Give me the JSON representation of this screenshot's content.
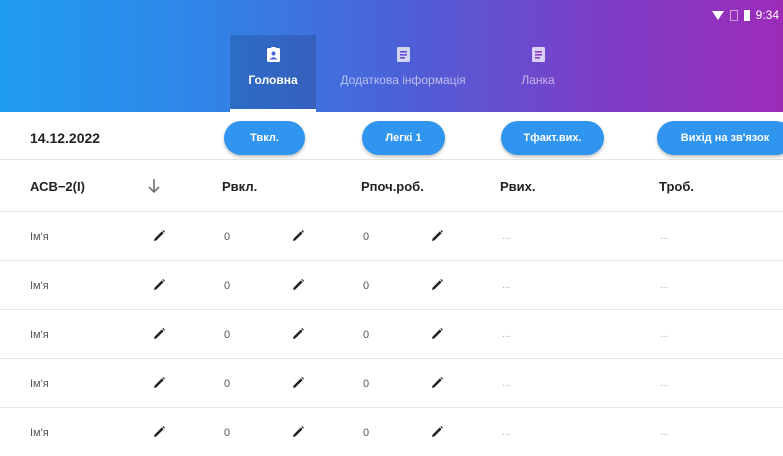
{
  "status_bar": {
    "time": "9:34"
  },
  "tabs": [
    {
      "label": "Головна",
      "active": true
    },
    {
      "label": "Додаткова інформація",
      "active": false
    },
    {
      "label": "Ланка",
      "active": false
    }
  ],
  "toolbar": {
    "date": "14.12.2022",
    "buttons": [
      "Твкл.",
      "Легкі 1",
      "Тфакт.вих.",
      "Вихід на зв'язок"
    ]
  },
  "table": {
    "headers": [
      "АСВ−2(І)",
      "Рвкл.",
      "Рпоч.роб.",
      "Рвих.",
      "Троб."
    ],
    "rows": [
      {
        "name": "Ім'я",
        "p_vkl": "0",
        "p_poch": "0",
        "p_vykh": "...",
        "t_rob": "..."
      },
      {
        "name": "Ім'я",
        "p_vkl": "0",
        "p_poch": "0",
        "p_vykh": "...",
        "t_rob": "..."
      },
      {
        "name": "Ім'я",
        "p_vkl": "0",
        "p_poch": "0",
        "p_vykh": "...",
        "t_rob": "..."
      },
      {
        "name": "Ім'я",
        "p_vkl": "0",
        "p_poch": "0",
        "p_vykh": "...",
        "t_rob": "..."
      },
      {
        "name": "Ім'я",
        "p_vkl": "0",
        "p_poch": "0",
        "p_vykh": "...",
        "t_rob": "..."
      }
    ]
  },
  "colors": {
    "gradient_start": "#1f9cf0",
    "gradient_end": "#9c2cb8",
    "button": "#2f95ee"
  },
  "icons": {
    "tab_1": "badge-icon",
    "tab_2": "document-icon",
    "tab_3": "document-icon",
    "sort": "arrow-down-icon",
    "edit": "pencil-icon"
  }
}
